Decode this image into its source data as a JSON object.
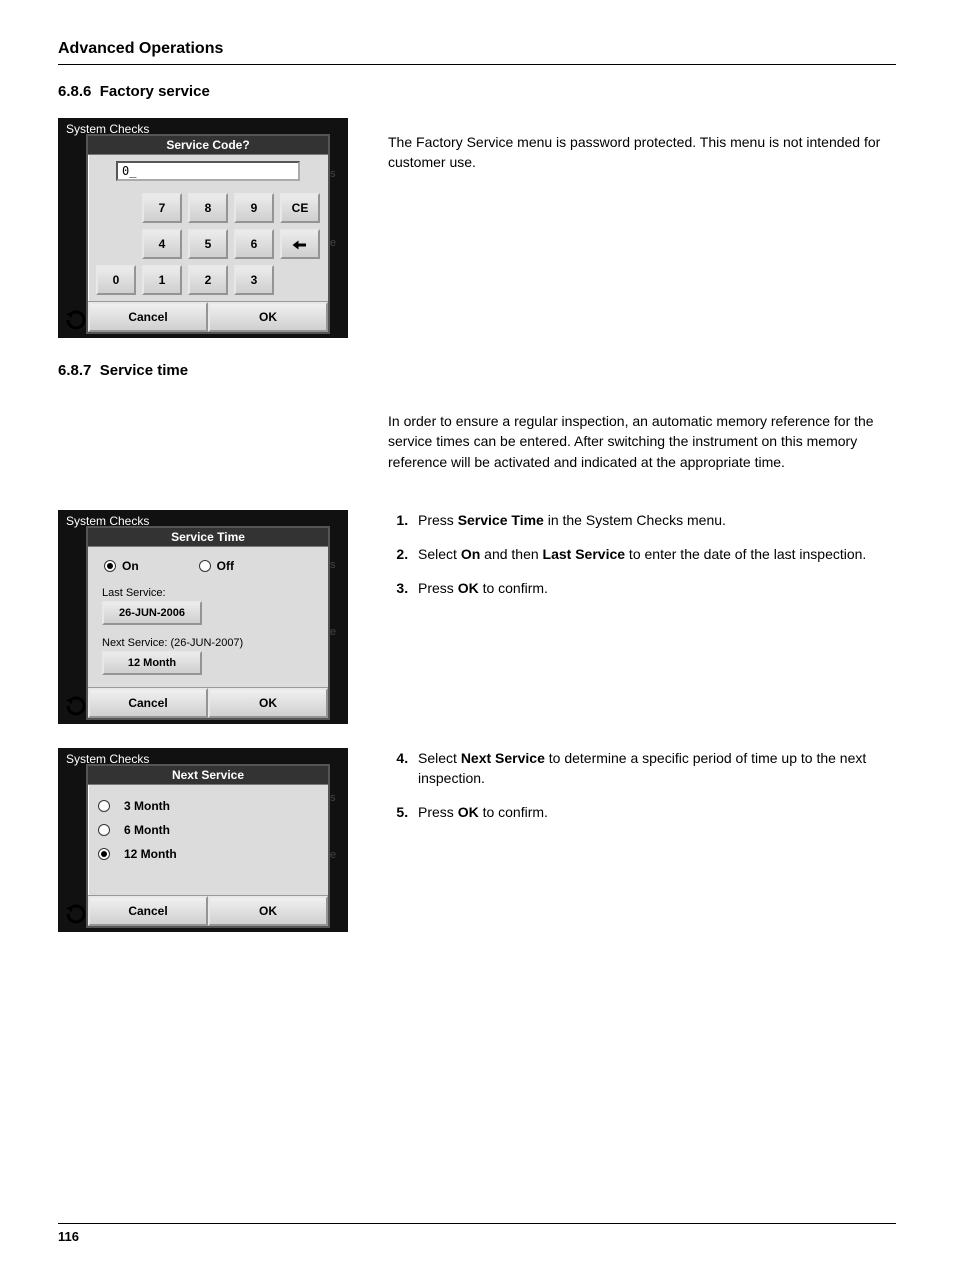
{
  "page": {
    "chapter": "Advanced Operations",
    "section1_num": "6.8.6",
    "section1_title": "Factory service",
    "section2_num": "6.8.7",
    "section2_title": "Service time",
    "para1": "The Factory Service menu is password protected. This menu is not intended for customer use.",
    "para2": "In order to ensure a regular inspection, an automatic memory reference for the service times can be entered. After switching the instrument on this memory reference will be activated and indicated at the appropriate time.",
    "page_number": "116"
  },
  "steps_a": [
    {
      "pre": "Press ",
      "b": "Service Time",
      "post": " in the System Checks menu."
    },
    {
      "pre": "Select ",
      "b": "On",
      "mid": " and then ",
      "b2": "Last Service",
      "post": " to enter the date of the last inspection."
    },
    {
      "pre": "Press ",
      "b": "OK",
      "post": " to confirm."
    }
  ],
  "steps_b": [
    {
      "pre": "Select ",
      "b": "Next Service",
      "post": " to determine a specific period of time up to the next inspection."
    },
    {
      "pre": "Press ",
      "b": "OK",
      "post": " to confirm."
    }
  ],
  "screen1": {
    "bg_title": "System Checks",
    "dialog_title": "Service Code?",
    "input_value": "0_",
    "keys": [
      [
        "",
        "7",
        "8",
        "9",
        "CE"
      ],
      [
        "",
        "4",
        "5",
        "6",
        "⬅"
      ],
      [
        "0",
        "1",
        "2",
        "3",
        ""
      ]
    ],
    "cancel": "Cancel",
    "ok": "OK",
    "side": [
      "s",
      "e"
    ]
  },
  "screen2": {
    "bg_title": "System Checks",
    "dialog_title": "Service Time",
    "radio_on": "On",
    "radio_off": "Off",
    "last_label": "Last Service:",
    "last_value": "26-JUN-2006",
    "next_label": "Next Service: (26-JUN-2007)",
    "next_value": "12 Month",
    "cancel": "Cancel",
    "ok": "OK",
    "side": [
      "s",
      "e"
    ]
  },
  "screen3": {
    "bg_title": "System Checks",
    "dialog_title": "Next Service",
    "opt1": "3 Month",
    "opt2": "6 Month",
    "opt3": "12 Month",
    "cancel": "Cancel",
    "ok": "OK",
    "side": [
      "s",
      "e"
    ]
  }
}
